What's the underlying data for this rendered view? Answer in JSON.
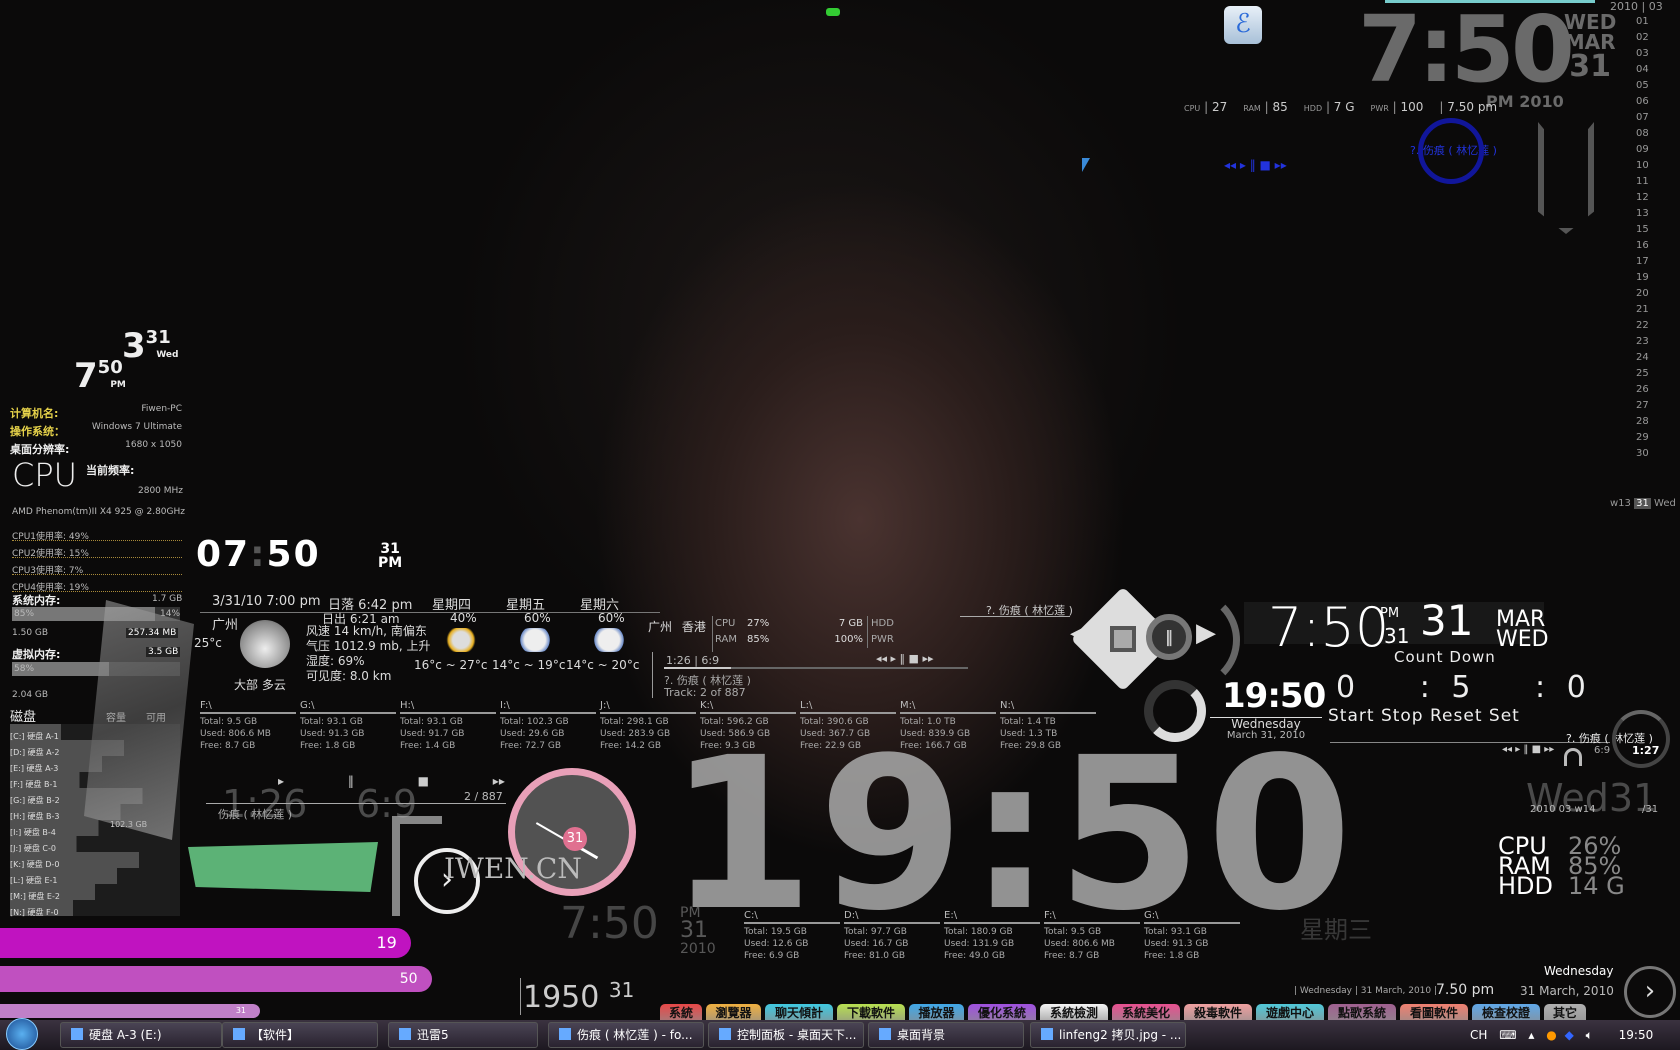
{
  "top_clock": {
    "time": "7:50",
    "dow": "WED",
    "month": "MAR",
    "date": "31",
    "ampm": "PM",
    "year": "2010"
  },
  "top_stats": {
    "items": [
      {
        "label": "CPU",
        "value": "27"
      },
      {
        "label": "RAM",
        "value": "85"
      },
      {
        "label": "HDD",
        "value": "7 G"
      },
      {
        "label": "PWR",
        "value": "100"
      }
    ],
    "time": "7.50 pm"
  },
  "calendar": {
    "year": "2010",
    "month": "03",
    "days": [
      "01",
      "02",
      "03",
      "04",
      "05",
      "06",
      "07",
      "08",
      "09",
      "10",
      "11",
      "12",
      "13",
      "15",
      "16",
      "17",
      "19",
      "20",
      "21",
      "22",
      "23",
      "24",
      "25",
      "26",
      "27",
      "28",
      "29",
      "30"
    ],
    "week": "w13",
    "today": "31",
    "dow": "Wed"
  },
  "blue_player": {
    "title": "?. 伤痕 ( 林忆莲 )"
  },
  "left_clock": {
    "month": "3",
    "date": "31",
    "dow": "Wed",
    "hour": "7",
    "minute": "50",
    "ampm": "PM"
  },
  "sysinfo": {
    "rows": [
      {
        "label": "计算机名:",
        "value": "Fiwen-PC"
      },
      {
        "label": "操作系统：",
        "value": "Windows 7 Ultimate"
      },
      {
        "label": "桌面分辨率:",
        "value": "1680 x 1050"
      }
    ],
    "cpu_logo": "CPU",
    "freq_label": "当前频率:",
    "freq": "2800 MHz",
    "cpu_name": "AMD Phenom(tm)II X4 925 @ 2.80GHz",
    "cores": [
      "CPU1使用率: 49%",
      "CPU2使用率: 15%",
      "CPU3使用率: 7%",
      "CPU4使用率: 19%"
    ],
    "mem": {
      "label": "系统内存:",
      "total": "1.7 GB",
      "used_pct": "85%",
      "free_pct": "14%",
      "used": "1.50 GB",
      "free": "257.34 MB",
      "used_fraction": 0.85
    },
    "vmem": {
      "label": "虚拟内存:",
      "total": "3.5 GB",
      "used_pct": "58%",
      "used": "2.04 GB",
      "used_fraction": 0.58
    }
  },
  "disks": {
    "header": [
      "磁盘",
      "容量",
      "可用"
    ],
    "rows": [
      {
        "name": "[C:] 硬盘 A-1",
        "size": ""
      },
      {
        "name": "[D:] 硬盘 A-2",
        "size": ""
      },
      {
        "name": "[E:] 硬盘 A-3",
        "size": ""
      },
      {
        "name": "[F:] 硬盘 B-1",
        "size": ""
      },
      {
        "name": "[G:] 硬盘 B-2",
        "size": ""
      },
      {
        "name": "[H:] 硬盘 B-3",
        "size": ""
      },
      {
        "name": "[I:] 硬盘 B-4",
        "size": "102.3 GB"
      },
      {
        "name": "[J:] 硬盘 C-0",
        "size": ""
      },
      {
        "name": "[K:] 硬盘 D-0",
        "size": ""
      },
      {
        "name": "[L:] 硬盘 E-1",
        "size": ""
      },
      {
        "name": "[M:] 硬盘 E-2",
        "size": ""
      },
      {
        "name": "[N:] 硬盘 F-0",
        "size": ""
      }
    ]
  },
  "digital_clock": {
    "hour": "07",
    "minute": "50",
    "date": "31",
    "ampm": "PM"
  },
  "weather": {
    "updated": "3/31/10 7:00 pm",
    "sunset": "日落 6:42 pm",
    "sunrise": "日出 6:21 am",
    "city": "广州",
    "temp": "25°c",
    "wind": "风速 14 km/h, 南偏东",
    "pressure": "气压 1012.9 mb, 上升",
    "humidity": "湿度: 69%",
    "visibility": "可见度: 8.0 km",
    "condition": "大部 多云",
    "forecast": [
      {
        "day": "星期四",
        "pop": "40%",
        "range": "16°c ~ 27°c",
        "icon": "sun-cloud-rain-icon"
      },
      {
        "day": "星期五",
        "pop": "60%",
        "range": "14°c ~ 19°c",
        "icon": "rain-icon"
      },
      {
        "day": "星期六",
        "pop": "60%",
        "range": "14°c ~ 20°c",
        "icon": "rain-icon"
      }
    ],
    "cities": [
      "广州",
      "香港"
    ]
  },
  "mini_stats": {
    "cpu_label": "CPU",
    "ram_label": "RAM",
    "cpu": "27%",
    "ram": "85%",
    "hdd": "7 GB",
    "pwr": "100%",
    "hdd_label": "HDD",
    "pwr_label": "PWR"
  },
  "music_bar": {
    "time": "1:26 | 6:9",
    "title": "?. 伤痕 ( 林忆莲 )",
    "track": "Track: 2 of 887",
    "progress": 0.22
  },
  "drives_top": [
    {
      "name": "F:\\",
      "total": "Total: 9.5 GB",
      "used": "Used: 806.6 MB",
      "free": "Free: 8.7 GB"
    },
    {
      "name": "G:\\",
      "total": "Total: 93.1 GB",
      "used": "Used: 91.3 GB",
      "free": "Free: 1.8 GB"
    },
    {
      "name": "H:\\",
      "total": "Total: 93.1 GB",
      "used": "Used: 91.7 GB",
      "free": "Free: 1.4 GB"
    },
    {
      "name": "I:\\",
      "total": "Total: 102.3 GB",
      "used": "Used: 29.6 GB",
      "free": "Free: 72.7 GB"
    },
    {
      "name": "J:\\",
      "total": "Total: 298.1 GB",
      "used": "Used: 283.9 GB",
      "free": "Free: 14.2 GB"
    },
    {
      "name": "K:\\",
      "total": "Total: 596.2 GB",
      "used": "Used: 586.9 GB",
      "free": "Free: 9.3 GB"
    },
    {
      "name": "L:\\",
      "total": "Total: 390.6 GB",
      "used": "Used: 367.7 GB",
      "free": "Free: 22.9 GB"
    },
    {
      "name": "M:\\",
      "total": "Total: 1.0 TB",
      "used": "Used: 839.9 GB",
      "free": "Free: 166.7 GB"
    },
    {
      "name": "N:\\",
      "total": "Total: 1.4 TB",
      "used": "Used: 1.3 TB",
      "free": "Free: 29.8 GB"
    }
  ],
  "drives_bottom": [
    {
      "name": "C:\\",
      "total": "Total: 19.5 GB",
      "used": "Used: 12.6 GB",
      "free": "Free: 6.9 GB"
    },
    {
      "name": "D:\\",
      "total": "Total: 97.7 GB",
      "used": "Used: 16.7 GB",
      "free": "Free: 81.0 GB"
    },
    {
      "name": "E:\\",
      "total": "Total: 180.9 GB",
      "used": "Used: 131.9 GB",
      "free": "Free: 49.0 GB"
    },
    {
      "name": "F:\\",
      "total": "Total: 9.5 GB",
      "used": "Used: 806.6 MB",
      "free": "Free: 8.7 GB"
    },
    {
      "name": "G:\\",
      "total": "Total: 93.1 GB",
      "used": "Used: 91.3 GB",
      "free": "Free: 1.8 GB"
    }
  ],
  "big_clock": "19:50",
  "left_player": {
    "elapsed": "1:26",
    "total": "6:9",
    "track": "2 / 887",
    "title": "伤痕 ( 林忆莲 )"
  },
  "pink_clock": {
    "date": "31"
  },
  "logo_text": "IWEN.CN",
  "faint_clock": {
    "time": "7:50",
    "ampm": "PM",
    "date": "31",
    "year": "2010",
    "dow": "星期三"
  },
  "strip_clock": {
    "hm": "1950",
    "date": "31"
  },
  "bars": [
    {
      "value": "19",
      "fraction": 0.79,
      "color": "#c013c0"
    },
    {
      "value": "50",
      "fraction": 0.83,
      "color": "#c050c0"
    },
    {
      "value": "31",
      "fraction": 0.5,
      "color": "#c080c8"
    }
  ],
  "right_clock": {
    "time": "7:50",
    "ampm": "PM",
    "small_date": "31",
    "date": "31",
    "month": "MAR",
    "dow": "WED"
  },
  "countdown": {
    "label": "Count Down",
    "h": "0",
    "m": "5",
    "s": "0",
    "start": "Start",
    "stop": "Stop",
    "reset": "Reset",
    "set": "Set"
  },
  "small_clock": {
    "time": "19:50",
    "dow": "Wednesday",
    "date": "March 31, 2010"
  },
  "right_player": {
    "title": "?. 伤痕 ( 林忆莲 )",
    "total": "6:9",
    "elapsed": "1:27"
  },
  "wed_widget": {
    "big": "Wed31",
    "sub": "2010 03 w14",
    "suffix": "/31"
  },
  "right_stats": [
    {
      "label": "CPU",
      "value": "26%"
    },
    {
      "label": "RAM",
      "value": "85%"
    },
    {
      "label": "HDD",
      "value": "14 G"
    }
  ],
  "bottom_date": {
    "dow": "Wednesday",
    "line": "| Wednesday | 31 March, 2010 |",
    "time": "7.50 pm",
    "date": "31 March, 2010"
  },
  "dock_tabs": [
    {
      "label": "系統",
      "color": "#e84848"
    },
    {
      "label": "瀏覽器",
      "color": "#f0b040"
    },
    {
      "label": "聊天傾計",
      "color": "#40c8e0"
    },
    {
      "label": "下載軟件",
      "color": "#b8e050"
    },
    {
      "label": "播放器",
      "color": "#40a8e8"
    },
    {
      "label": "優化系統",
      "color": "#a050e0"
    },
    {
      "label": "系統檢測",
      "color": "#f4f4f4"
    },
    {
      "label": "系統美化",
      "color": "#e85090"
    },
    {
      "label": "殺毒軟件",
      "color": "#f0a0a0"
    },
    {
      "label": "遊戲中心",
      "color": "#50c8d8"
    },
    {
      "label": "點歌系統",
      "color": "#a06090"
    },
    {
      "label": "看圖軟件",
      "color": "#f08070"
    },
    {
      "label": "檢查校證",
      "color": "#60a8e8"
    },
    {
      "label": "其它",
      "color": "#b0b0b0"
    }
  ],
  "taskbar": {
    "items": [
      "硬盘 A-3 (E:)",
      "【软件】",
      "迅雷5",
      "伤痕 ( 林忆莲 ) - fo...",
      "控制面板 - 桌面天下...",
      "桌面背景",
      "linfeng2 拷贝.jpg - ..."
    ],
    "lang": "CH",
    "clock": "19:50"
  }
}
